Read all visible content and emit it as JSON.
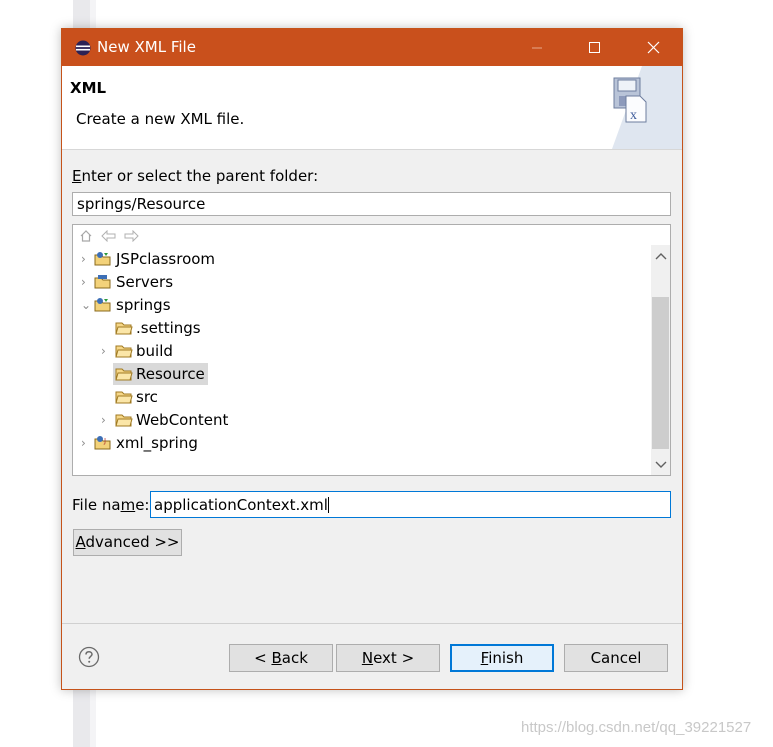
{
  "window": {
    "title": "New XML File",
    "accent": "#c9501c"
  },
  "header": {
    "title": "XML",
    "description": "Create a new XML file."
  },
  "folder": {
    "label_pre": "",
    "label_u": "E",
    "label_post": "nter or select the parent folder:",
    "value": "springs/Resource"
  },
  "tree": {
    "items": [
      {
        "label": "JSPclassroom",
        "expander": "›"
      },
      {
        "label": "Servers",
        "expander": "›"
      },
      {
        "label": "springs",
        "expander": "⌄"
      },
      {
        "label": ".settings",
        "expander": ""
      },
      {
        "label": "build",
        "expander": "›"
      },
      {
        "label": "Resource",
        "expander": ""
      },
      {
        "label": "src",
        "expander": ""
      },
      {
        "label": "WebContent",
        "expander": "›"
      },
      {
        "label": "xml_spring",
        "expander": "›"
      }
    ]
  },
  "filename": {
    "label_pre": "File na",
    "label_u": "m",
    "label_post": "e:",
    "value": "applicationContext.xml"
  },
  "buttons": {
    "advanced_u": "A",
    "advanced_post": "dvanced >>",
    "back_pre": "< ",
    "back_u": "B",
    "back_post": "ack",
    "next_u": "N",
    "next_post": "ext >",
    "finish_u": "F",
    "finish_post": "inish",
    "cancel": "Cancel"
  },
  "watermark": "https://blog.csdn.net/qq_39221527"
}
